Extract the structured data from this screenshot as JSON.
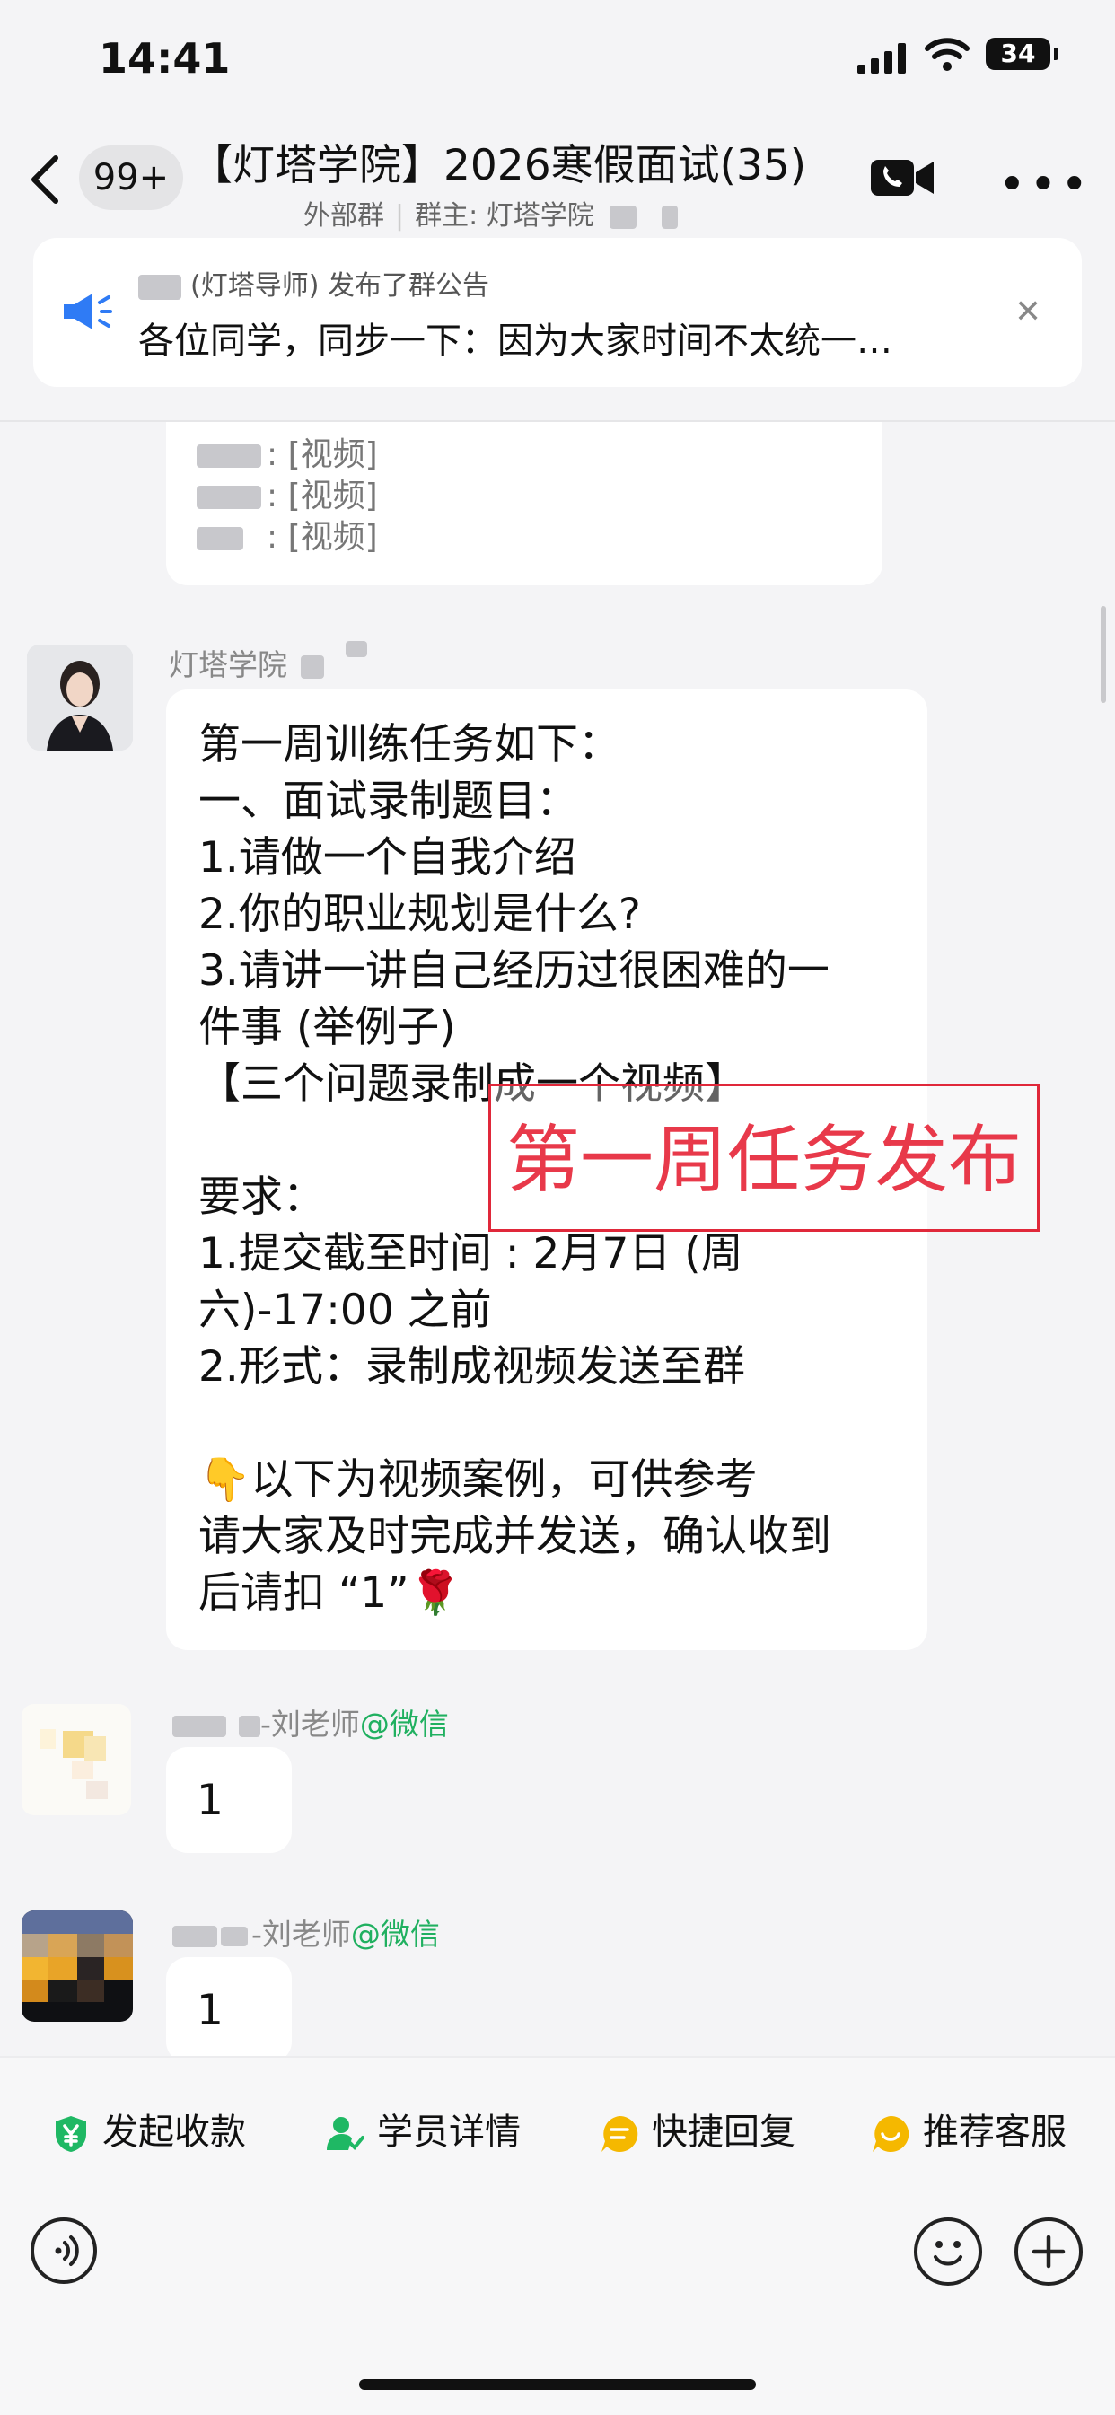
{
  "status_bar": {
    "time": "14:41",
    "battery": "34"
  },
  "header": {
    "badge": "99+",
    "title": "【灯塔学院】2026寒假面试(35)",
    "subtitle_type": "外部群",
    "subtitle_owner": "群主: 灯塔学院"
  },
  "notice": {
    "author_line": "(灯塔导师) 发布了群公告",
    "text": "各位同学，同步一下：因为大家时间不太统一…",
    "close_icon": "close-icon"
  },
  "messages": {
    "video_list": [
      ": [视频]",
      ": [视频]",
      ": [视频]"
    ],
    "main": {
      "sender": "灯塔学院",
      "text": "第一周训练任务如下：\n一、面试录制题目：\n1.请做一个自我介绍\n2.你的职业规划是什么?\n3.请讲一讲自己经历过很困难的一\n件事 (举例子)\n【三个问题录制成一个视频】\n\n要求：\n1.提交截至时间 : 2月7日 (周\n六)-17:00 之前\n2.形式：录制成视频发送至群\n\n👇以下为视频案例，可供参考\n请大家及时完成并发送，确认收到\n后请扣 “1”🌹"
    },
    "reply1": {
      "sender": "-刘老师",
      "platform": "@微信",
      "text": "1"
    },
    "reply2": {
      "sender": "-刘老师",
      "platform": "@微信",
      "text": "1"
    }
  },
  "annotation": {
    "text": "第一周任务发布",
    "color": "#e0283a"
  },
  "quick_actions": [
    {
      "label": "发起收款",
      "color": "#1fb864"
    },
    {
      "label": "学员详情",
      "color": "#1fb864"
    },
    {
      "label": "快捷回复",
      "color": "#f5b800"
    },
    {
      "label": "推荐客服",
      "color": "#f5b800"
    }
  ]
}
